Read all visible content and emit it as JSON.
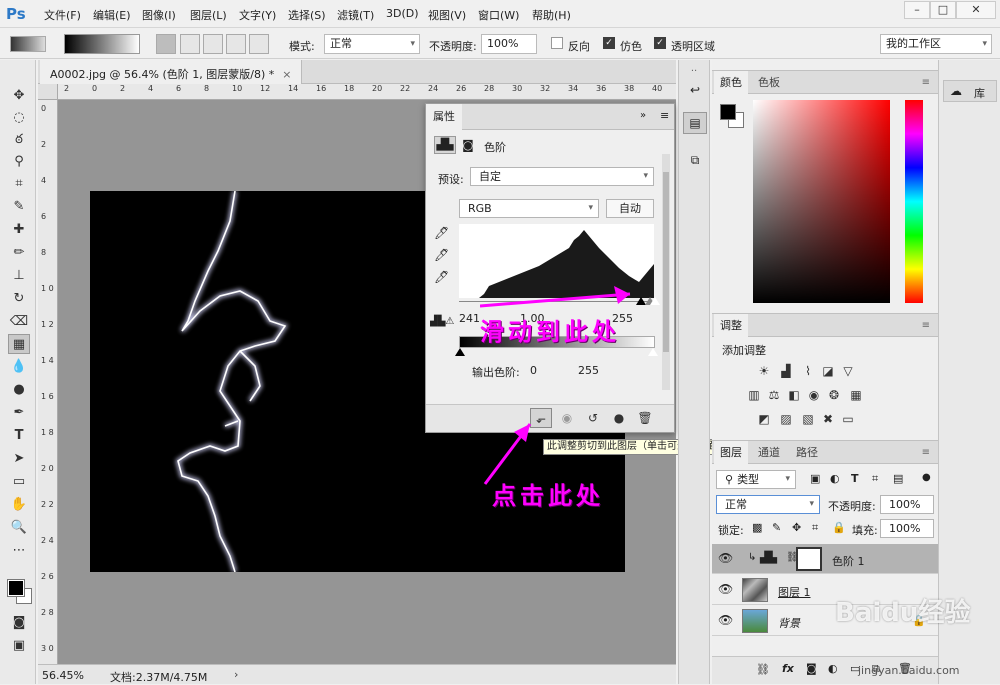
{
  "app": {
    "logo": "Ps"
  },
  "menu": [
    "文件(F)",
    "编辑(E)",
    "图像(I)",
    "图层(L)",
    "文字(Y)",
    "选择(S)",
    "滤镜(T)",
    "3D(D)",
    "视图(V)",
    "窗口(W)",
    "帮助(H)"
  ],
  "window_controls": {
    "minimize": "–",
    "restore": "□",
    "close": "✕"
  },
  "options": {
    "mode_label": "模式:",
    "mode_value": "正常",
    "opacity_label": "不透明度:",
    "opacity_value": "100%",
    "reverse_label": "反向",
    "dither_label": "仿色",
    "transparency_label": "透明区域",
    "workspace": "我的工作区"
  },
  "document": {
    "tab_title": "A0002.jpg @ 56.4% (色阶 1, 图层蒙版/8) *",
    "zoom": "56.45%",
    "doc_info": "文档:2.37M/4.75M"
  },
  "ruler": {
    "h_ticks": [
      "2",
      "0",
      "2",
      "4",
      "6",
      "8",
      "10",
      "12",
      "14",
      "16",
      "18",
      "20",
      "22",
      "24",
      "26",
      "28",
      "30",
      "32",
      "34",
      "36",
      "38",
      "40"
    ],
    "v_ticks": [
      "0",
      "2",
      "4",
      "6",
      "8",
      "1 0",
      "1 2",
      "1 4",
      "1 6",
      "1 8",
      "2 0",
      "2 2",
      "2 4",
      "2 6",
      "2 8",
      "3 0"
    ]
  },
  "properties": {
    "tab": "属性",
    "layer_type": "色阶",
    "preset_label": "预设:",
    "preset_value": "自定",
    "channel": "RGB",
    "auto_button": "自动",
    "input_black": "241",
    "input_mid": "1.00",
    "input_white": "255",
    "output_label": "输出色阶:",
    "output_black": "0",
    "output_white": "255",
    "footer_icons": [
      "clip-to-layer-icon",
      "view-previous-icon",
      "reset-icon",
      "visibility-icon",
      "delete-icon"
    ]
  },
  "tooltip": "此调整剪切到此图层（单击可影响下面的所有图层）",
  "annotations": {
    "slide_here": "滑动到此处",
    "click_here": "点击此处"
  },
  "panels": {
    "color_tab": "颜色",
    "swatches_tab": "色板",
    "adjustments_tab": "调整",
    "adjustments_add": "添加调整",
    "layers_tab": "图层",
    "channels_tab": "通道",
    "paths_tab": "路径",
    "filter_kind": "类型",
    "blend_mode": "正常",
    "layer_opacity_label": "不透明度:",
    "layer_opacity_value": "100%",
    "lock_label": "锁定:",
    "fill_label": "填充:",
    "fill_value": "100%",
    "library_tab": "库"
  },
  "layers": [
    {
      "name": "色阶 1",
      "type": "adjustment",
      "selected": true
    },
    {
      "name": "图层 1",
      "type": "pixel",
      "selected": false
    },
    {
      "name": "背景",
      "type": "background",
      "selected": false
    }
  ],
  "watermark": {
    "brand": "Baidu经验",
    "url": "jingyan.baidu.com"
  },
  "colors": {
    "foreground": "#000000",
    "background": "#ffffff",
    "annotation": "#ff00ff"
  }
}
